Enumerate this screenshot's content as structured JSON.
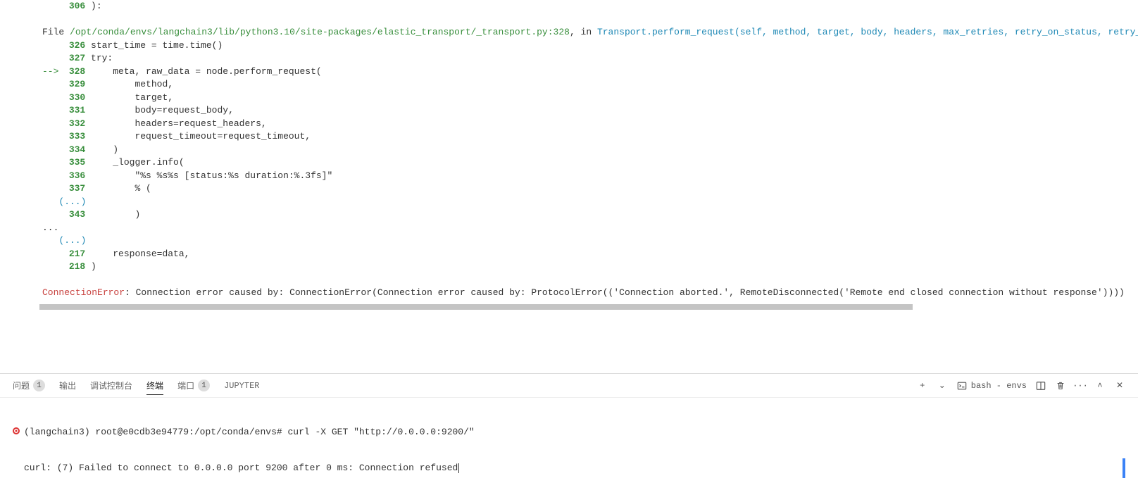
{
  "traceback": {
    "top_line_num": "306",
    "top_line_code": "):",
    "file_prefix": "File ",
    "file_path": "/opt/conda/envs/langchain3/lib/python3.10/site-packages/elastic_transport/_transport.py:328",
    "in_text": ", in ",
    "func_sig": "Transport.perform_request(self, method, target, body, headers, max_retries, retry_on_status, retry_",
    "lines": [
      {
        "num": "326",
        "arrow": "    ",
        "code": "start_time = time.time()"
      },
      {
        "num": "327",
        "arrow": "    ",
        "code": "try:"
      },
      {
        "num": "328",
        "arrow": "--> ",
        "code": "    meta, raw_data = node.perform_request("
      },
      {
        "num": "329",
        "arrow": "    ",
        "code": "        method,"
      },
      {
        "num": "330",
        "arrow": "    ",
        "code": "        target,"
      },
      {
        "num": "331",
        "arrow": "    ",
        "code": "        body=request_body,"
      },
      {
        "num": "332",
        "arrow": "    ",
        "code": "        headers=request_headers,"
      },
      {
        "num": "333",
        "arrow": "    ",
        "code": "        request_timeout=request_timeout,"
      },
      {
        "num": "334",
        "arrow": "    ",
        "code": "    )"
      },
      {
        "num": "335",
        "arrow": "    ",
        "code": "    _logger.info("
      },
      {
        "num": "336",
        "arrow": "    ",
        "code": "        \"%s %s%s [status:%s duration:%.3fs]\""
      },
      {
        "num": "337",
        "arrow": "    ",
        "code": "        % ("
      }
    ],
    "ellipsis1": "(...)",
    "line343_num": "343",
    "line343_code": "        )",
    "dots": "...",
    "ellipsis2": "(...)",
    "line217_num": "217",
    "line217_code": "    response=data,",
    "line218_num": "218",
    "line218_code": ")",
    "error_name": "ConnectionError",
    "error_msg": ": Connection error caused by: ConnectionError(Connection error caused by: ProtocolError(('Connection aborted.', RemoteDisconnected('Remote end closed connection without response'))))"
  },
  "tabs": {
    "problems": "问题",
    "problems_count": "1",
    "output": "输出",
    "debug": "调试控制台",
    "terminal": "终端",
    "ports": "端口",
    "ports_count": "1",
    "jupyter": "JUPYTER",
    "shell_label": "bash - envs"
  },
  "terminal": {
    "prompt_env": "(langchain3) ",
    "prompt_rest": "root@e0cdb3e94779:/opt/conda/envs# ",
    "cmd": "curl -X GET \"http://0.0.0.0:9200/\"",
    "out": "curl: (7) Failed to connect to 0.0.0.0 port 9200 after 0 ms: Connection refused"
  },
  "icons": {
    "plus": "+",
    "chevdown": "⌄",
    "terminal": "▢",
    "split": "▥",
    "trash": "🗑",
    "more": "···",
    "up": "˄",
    "close": "✕"
  }
}
